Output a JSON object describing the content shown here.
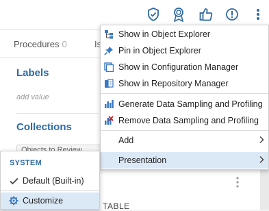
{
  "topbar": {
    "icons": [
      "shield-icon",
      "award-icon",
      "thumbs-up-icon",
      "alert-icon",
      "more-vertical-icon"
    ],
    "accent": "#2e6aa5"
  },
  "tabs": [
    {
      "label": "Procedures",
      "count": "0"
    },
    {
      "label": "Is"
    }
  ],
  "labels_section": {
    "title": "Labels",
    "placeholder": "add value"
  },
  "collections_section": {
    "title": "Collections",
    "chip": "Objects to Review"
  },
  "bottom_text": "TABLE",
  "menu": {
    "items": [
      {
        "label": "Show in Object Explorer",
        "icon": "object-explorer-icon"
      },
      {
        "label": "Pin in Object Explorer",
        "icon": "pin-icon"
      },
      {
        "label": "Show in Configuration Manager",
        "icon": "configuration-manager-icon"
      },
      {
        "label": "Show in Repository Manager",
        "icon": "repository-manager-icon"
      },
      {
        "label": "Generate Data Sampling and Profiling",
        "icon": "bar-chart-icon"
      },
      {
        "label": "Remove Data Sampling and Profiling",
        "icon": "remove-chart-icon"
      },
      {
        "label": "Add",
        "icon": "chevron-right-icon"
      },
      {
        "label": "Presentation",
        "icon": "chevron-right-icon"
      }
    ],
    "highlight_color": "#dbe8f6"
  },
  "submenu": {
    "header": "SYSTEM",
    "items": [
      {
        "label": "Default (Built-in)",
        "icon": "checkmark-icon"
      },
      {
        "label": "Customize",
        "icon": "gear-icon"
      }
    ]
  }
}
